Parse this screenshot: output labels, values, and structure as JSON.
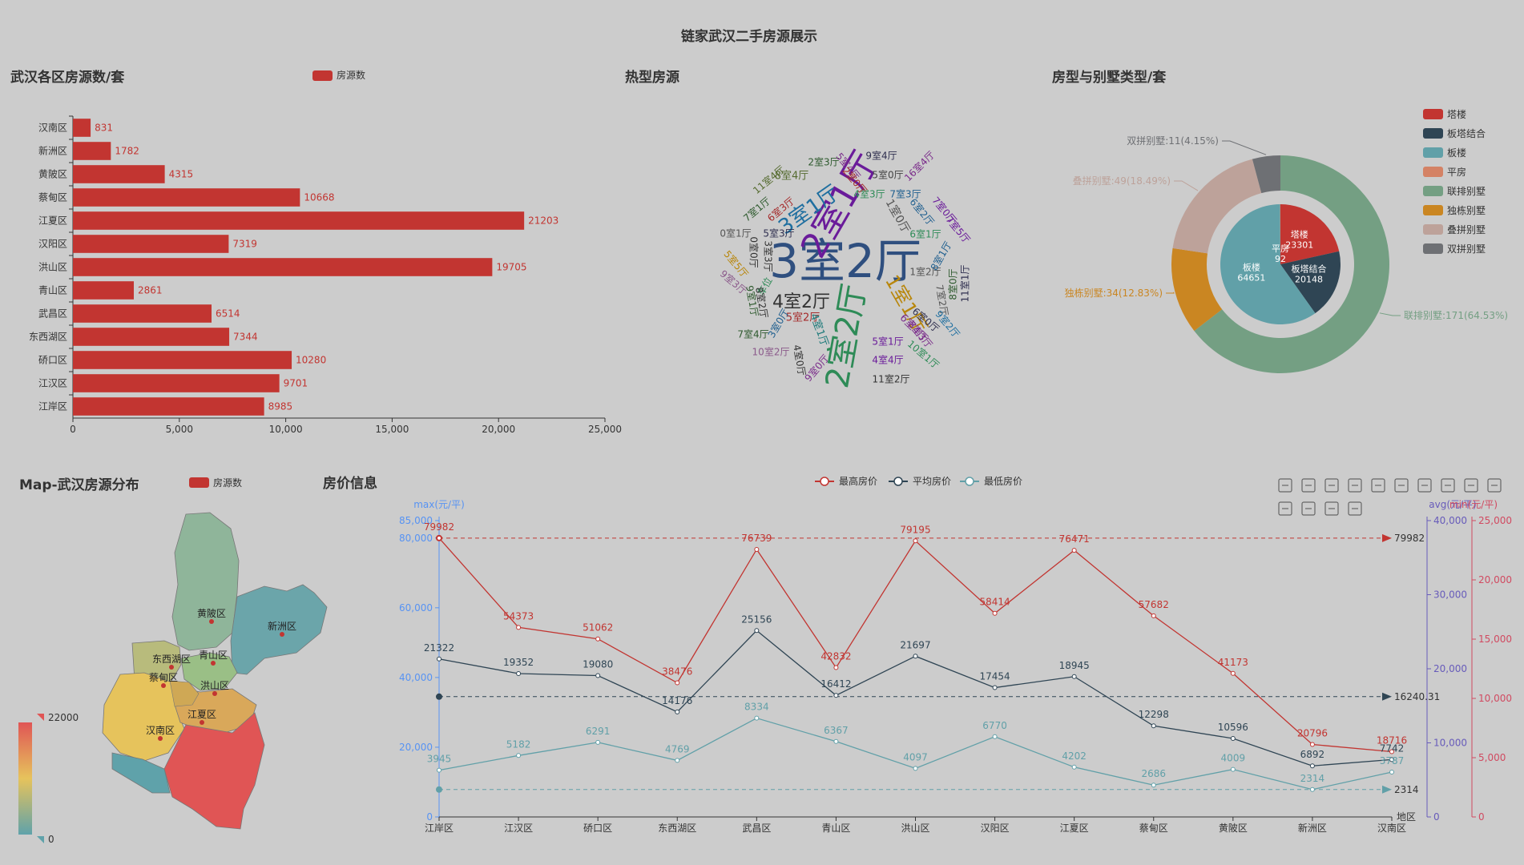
{
  "page_title": "链家武汉二手房源展示",
  "chart_data": [
    {
      "id": "bar",
      "type": "bar",
      "title": "武汉各区房源数/套",
      "legend": "房源数",
      "legend_position": "top",
      "orientation": "horizontal",
      "color": "#c23531",
      "categories": [
        "汉南区",
        "新洲区",
        "黄陂区",
        "蔡甸区",
        "江夏区",
        "汉阳区",
        "洪山区",
        "青山区",
        "武昌区",
        "东西湖区",
        "硚口区",
        "江汉区",
        "江岸区"
      ],
      "values": [
        831,
        1782,
        4315,
        10668,
        21203,
        7319,
        19705,
        2861,
        6514,
        7344,
        10280,
        9701,
        8985
      ],
      "xlim": [
        0,
        25000
      ],
      "xticks": [
        "0",
        "5,000",
        "10,000",
        "15,000",
        "20,000",
        "25,000"
      ]
    },
    {
      "id": "wordcloud",
      "type": "wordcloud",
      "title": "热型房源",
      "words": [
        {
          "text": "3室2厅",
          "color": "#2f4f7f",
          "rot": 0
        },
        {
          "text": "2室1厅",
          "color": "#6a1b9a",
          "rot": 60
        },
        {
          "text": "2室2厅",
          "color": "#2e8b57",
          "rot": 80
        },
        {
          "text": "3室1厅",
          "color": "#1f6fa0",
          "rot": 35
        },
        {
          "text": "4室2厅",
          "color": "#333333",
          "rot": 0
        },
        {
          "text": "1室1厅",
          "color": "#b8860b",
          "rot": -60
        },
        {
          "text": "1室0厅",
          "color": "#555555",
          "rot": -60
        },
        {
          "text": "5室2厅",
          "color": "#a52a2a",
          "rot": 0
        },
        {
          "text": "4室1厅",
          "color": "#1e7a7a",
          "rot": -70
        },
        {
          "text": "6室4厅",
          "color": "#7b2d8b",
          "rot": -45
        },
        {
          "text": "8室4厅",
          "color": "#556b2f",
          "rot": 0
        },
        {
          "text": "2室3厅",
          "color": "#2e5a2e",
          "rot": 0
        },
        {
          "text": "9室4厅",
          "color": "#2f2f4f",
          "rot": 0
        },
        {
          "text": "16室4厅",
          "color": "#7b2d8b",
          "rot": 45
        },
        {
          "text": "5室0厅",
          "color": "#444444",
          "rot": 0
        },
        {
          "text": "4室3厅",
          "color": "#2e8b57",
          "rot": 0
        },
        {
          "text": "7室3厅",
          "color": "#1f5f8f",
          "rot": 0
        },
        {
          "text": "11室4厅",
          "color": "#556b2f",
          "rot": 40
        },
        {
          "text": "5室4厅",
          "color": "#7b2d8b",
          "rot": -50
        },
        {
          "text": "2室0厅",
          "color": "#a52a2a",
          "rot": -50
        },
        {
          "text": "6室3厅",
          "color": "#a52a2a",
          "rot": 40
        },
        {
          "text": "7室1厅",
          "color": "#2e5a2e",
          "rot": 40
        },
        {
          "text": "0室1厅",
          "color": "#555555",
          "rot": 0
        },
        {
          "text": "5室3厅",
          "color": "#2f2f4f",
          "rot": 0
        },
        {
          "text": "6室2厅",
          "color": "#1f5f8f",
          "rot": -50
        },
        {
          "text": "7室0厅",
          "color": "#6a1b9a",
          "rot": -50
        },
        {
          "text": "6室1厅",
          "color": "#2e8b57",
          "rot": 0
        },
        {
          "text": "7室5厅",
          "color": "#6a1b9a",
          "rot": -50
        },
        {
          "text": "5室5厅",
          "color": "#b8860b",
          "rot": -50
        },
        {
          "text": "0室0厅",
          "color": "#333333",
          "rot": -90
        },
        {
          "text": "3室3厅",
          "color": "#333333",
          "rot": -90
        },
        {
          "text": "9室3厅",
          "color": "#8b5a8b",
          "rot": -40
        },
        {
          "text": "车位",
          "color": "#2e8b57",
          "rot": 60
        },
        {
          "text": "1室2厅",
          "color": "#555555",
          "rot": 0
        },
        {
          "text": "8室1厅",
          "color": "#1f5f8f",
          "rot": 60
        },
        {
          "text": "11室1厅",
          "color": "#2f2f4f",
          "rot": 90
        },
        {
          "text": "9室1厅",
          "color": "#2e5a2e",
          "rot": -80
        },
        {
          "text": "8室2厅",
          "color": "#333333",
          "rot": -80
        },
        {
          "text": "3室0厅",
          "color": "#1f5f8f",
          "rot": 60
        },
        {
          "text": "5室1厅",
          "color": "#6a1b9a",
          "rot": 0
        },
        {
          "text": "8室0厅",
          "color": "#2e5a2e",
          "rot": 90
        },
        {
          "text": "7室2厅",
          "color": "#555555",
          "rot": -80
        },
        {
          "text": "6室0厅",
          "color": "#2f2f4f",
          "rot": -40
        },
        {
          "text": "9室2厅",
          "color": "#1f6fa0",
          "rot": -50
        },
        {
          "text": "8室3厅",
          "color": "#7b2d8b",
          "rot": -50
        },
        {
          "text": "7室4厅",
          "color": "#2e5a2e",
          "rot": 0
        },
        {
          "text": "10室2厅",
          "color": "#8b5a8b",
          "rot": 0
        },
        {
          "text": "4室0厅",
          "color": "#333333",
          "rot": -80
        },
        {
          "text": "9室0厅",
          "color": "#7b2d8b",
          "rot": 50
        },
        {
          "text": "4室4厅",
          "color": "#6a1b9a",
          "rot": 0
        },
        {
          "text": "10室1厅",
          "color": "#2e8b57",
          "rot": -40
        },
        {
          "text": "11室2厅",
          "color": "#333333",
          "rot": 0
        }
      ]
    },
    {
      "id": "pie",
      "type": "pie",
      "title": "房型与别墅类型/套",
      "legend_position": "right",
      "inner": [
        {
          "name": "塔楼",
          "value": 23301,
          "color": "#c23531"
        },
        {
          "name": "板塔结合",
          "value": 20148,
          "color": "#2f4554"
        },
        {
          "name": "板楼",
          "value": 64651,
          "color": "#61a0a8"
        },
        {
          "name": "平房",
          "value": 92,
          "color": "#d48265"
        }
      ],
      "outer": [
        {
          "name": "联排别墅",
          "value": 171,
          "pct": "64.53%",
          "label": "联排别墅:171(64.53%)",
          "color": "#749f83"
        },
        {
          "name": "独栋别墅",
          "value": 34,
          "pct": "12.83%",
          "label": "独栋别墅:34(12.83%)",
          "color": "#ca8622"
        },
        {
          "name": "叠拼别墅",
          "value": 49,
          "pct": "18.49%",
          "label": "叠拼别墅:49(18.49%)",
          "color": "#bda29a"
        },
        {
          "name": "双拼别墅",
          "value": 11,
          "pct": "4.15%",
          "label": "双拼别墅:11(4.15%)",
          "color": "#6e7074"
        }
      ],
      "legend_items": [
        "塔楼",
        "板塔结合",
        "板楼",
        "平房",
        "联排别墅",
        "独栋别墅",
        "叠拼别墅",
        "双拼别墅"
      ],
      "legend_colors": [
        "#c23531",
        "#2f4554",
        "#61a0a8",
        "#d48265",
        "#749f83",
        "#ca8622",
        "#bda29a",
        "#6e7074"
      ]
    },
    {
      "id": "map",
      "type": "map",
      "title": "Map-武汉房源分布",
      "legend": "房源数",
      "visual_max": "22000",
      "visual_min": "0",
      "district_labels": [
        "黄陂区",
        "新洲区",
        "东西湖区",
        "青山区",
        "蔡甸区",
        "洪山区",
        "江夏区",
        "汉南区"
      ]
    },
    {
      "id": "line",
      "type": "line",
      "title": "房价信息",
      "legend": [
        "最高房价",
        "平均房价",
        "最低房价"
      ],
      "categories": [
        "江岸区",
        "江汉区",
        "硚口区",
        "东西湖区",
        "武昌区",
        "青山区",
        "洪山区",
        "汉阳区",
        "江夏区",
        "蔡甸区",
        "黄陂区",
        "新洲区",
        "汉南区"
      ],
      "x_axis_name": "地区",
      "series": [
        {
          "name": "最高房价",
          "axis": "max",
          "color": "#c23531",
          "values": [
            79982,
            54373,
            51062,
            38476,
            76739,
            42832,
            79195,
            58414,
            76471,
            57682,
            41173,
            20796,
            18716
          ],
          "markline": "79982"
        },
        {
          "name": "平均房价",
          "axis": "avg",
          "color": "#2f4554",
          "values": [
            21322,
            19352,
            19080,
            14176,
            25156,
            16412,
            21697,
            17454,
            18945,
            12298,
            10596,
            6892,
            7742
          ],
          "markline": "16240.31"
        },
        {
          "name": "最低房价",
          "axis": "min",
          "color": "#61a0a8",
          "values": [
            3945,
            5182,
            6291,
            4769,
            8334,
            6367,
            4097,
            6770,
            4202,
            2686,
            4009,
            2314,
            3787
          ],
          "markline": "2314"
        }
      ],
      "axes": {
        "max": {
          "name": "max(元/平)",
          "range": [
            0,
            85000
          ],
          "ticks": [
            "0",
            "20,000",
            "40,000",
            "60,000",
            "80,000",
            "85,000"
          ],
          "tick_values": [
            0,
            20000,
            40000,
            60000,
            80000,
            85000
          ],
          "color": "#5793f3"
        },
        "avg": {
          "name": "avg(元/平)",
          "range": [
            0,
            40000
          ],
          "ticks": [
            "0",
            "10,000",
            "20,000",
            "30,000",
            "40,000"
          ],
          "tick_values": [
            0,
            10000,
            20000,
            30000,
            40000
          ],
          "color": "#675bba"
        },
        "min": {
          "name": "min(元/平)",
          "range": [
            0,
            25000
          ],
          "ticks": [
            "0",
            "5,000",
            "10,000",
            "15,000",
            "20,000",
            "25,000"
          ],
          "tick_values": [
            0,
            5000,
            10000,
            15000,
            20000,
            25000
          ],
          "color": "#d14a61"
        }
      }
    }
  ],
  "toolbar": {
    "icons": [
      "download-icon",
      "refresh-icon",
      "data-view-icon",
      "zoom-icon",
      "zoom-reset-icon",
      "line-icon",
      "bar-icon",
      "stack-icon",
      "brush-rect-icon",
      "brush-polygon-icon",
      "brush-line-x-icon",
      "brush-line-y-icon",
      "brush-keep-icon",
      "brush-clear-icon"
    ]
  }
}
